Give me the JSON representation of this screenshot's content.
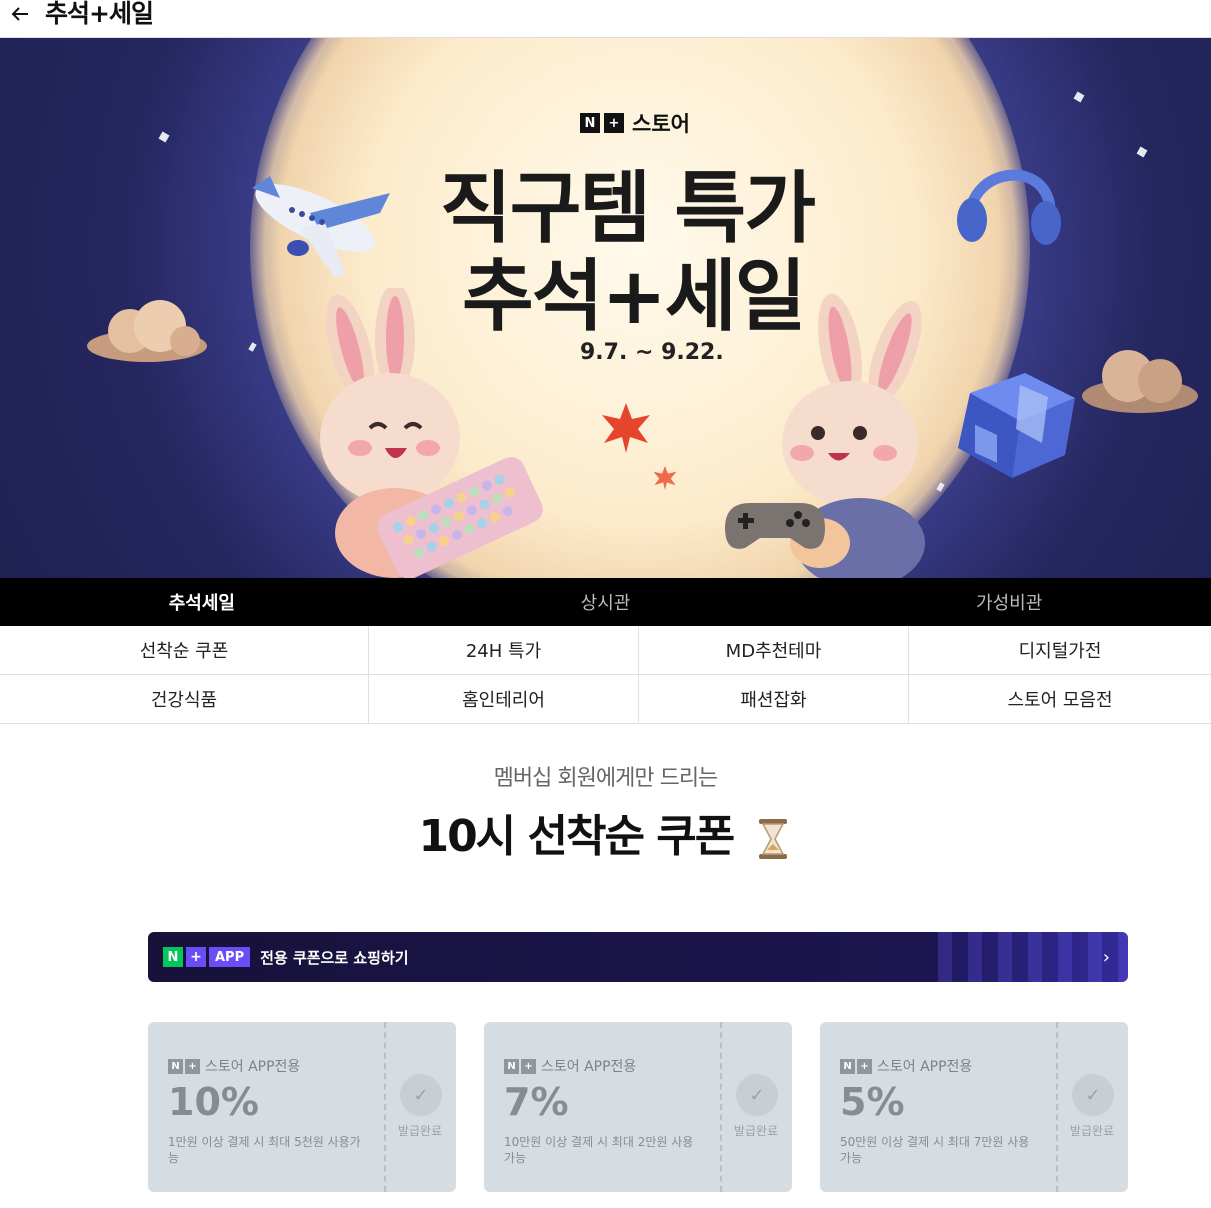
{
  "header": {
    "title": "추석+세일"
  },
  "hero": {
    "brand_mark_n": "N",
    "brand_mark_plus": "+",
    "brand_text": "스토어",
    "title_line1": "직구템 특가",
    "title_line2": "추석+세일",
    "date": "9.7. ~ 9.22."
  },
  "category_tabs": [
    {
      "label": "추석세일"
    },
    {
      "label": "상시관"
    },
    {
      "label": "가성비관"
    }
  ],
  "sub_menu": {
    "row1": [
      "선착순 쿠폰",
      "24H 특가",
      "MD추천테마",
      "디지털가전"
    ],
    "row2": [
      "건강식품",
      "홈인테리어",
      "패션잡화",
      "스토어 모음전"
    ]
  },
  "section": {
    "subtitle": "멤버십 회원에게만 드리는",
    "title": "10시 선착순 쿠폰"
  },
  "app_banner": {
    "n": "N",
    "plus": "+",
    "app": "APP",
    "text": "전용 쿠폰으로 쇼핑하기"
  },
  "coupons": [
    {
      "n": "N",
      "plus": "+",
      "label": "스토어 APP전용",
      "rate": "10%",
      "condition": "1만원 이상 결제 시 최대 5천원 사용가능",
      "status": "발급완료"
    },
    {
      "n": "N",
      "plus": "+",
      "label": "스토어 APP전용",
      "rate": "7%",
      "condition": "10만원 이상 결제 시 최대 2만원 사용가능",
      "status": "발급완료"
    },
    {
      "n": "N",
      "plus": "+",
      "label": "스토어 APP전용",
      "rate": "5%",
      "condition": "50만원 이상 결제 시 최대 7만원 사용가능",
      "status": "발급완료"
    }
  ],
  "colors": {
    "active_tab_bg": "#000000",
    "coupon_bg": "#d5dde2",
    "naver_green": "#03c75a",
    "accent_purple": "#6b4cf5"
  }
}
